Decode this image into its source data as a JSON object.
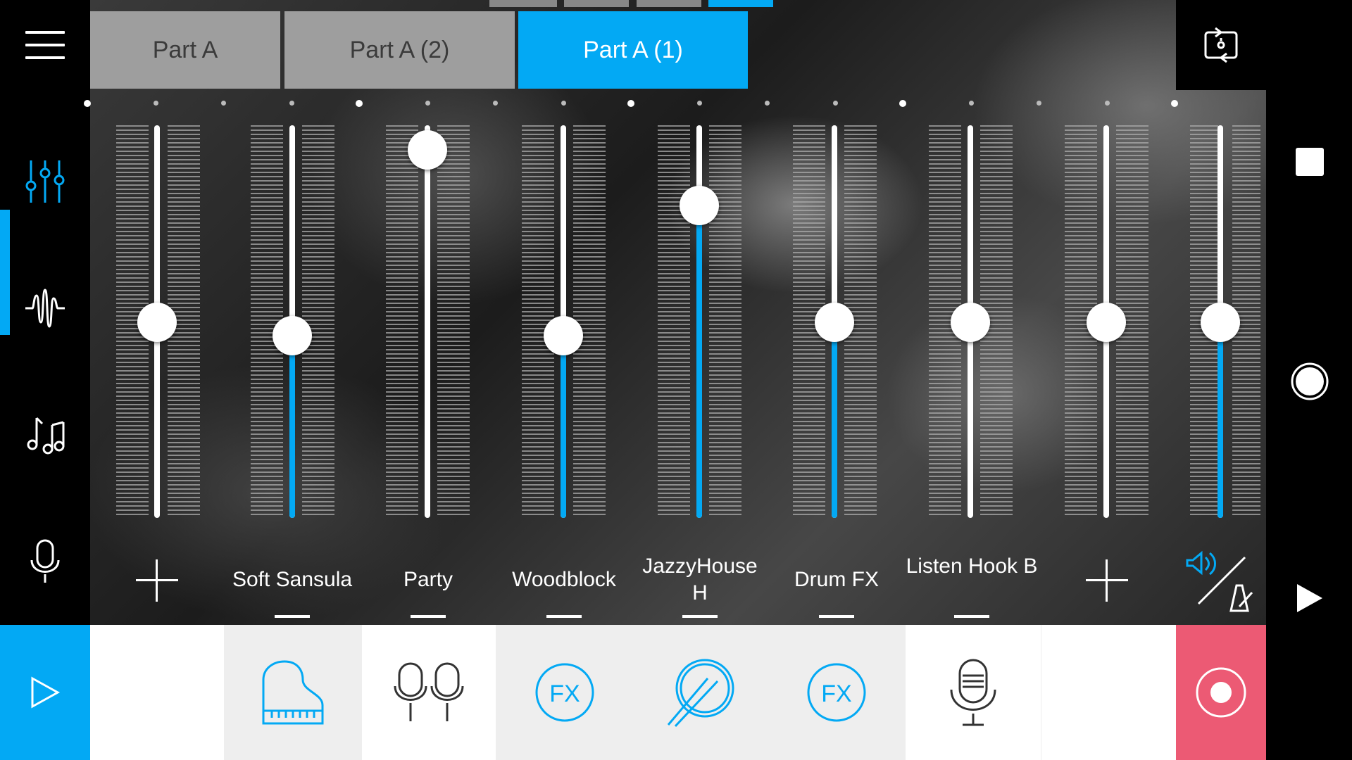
{
  "tabs": [
    {
      "label": "Part A"
    },
    {
      "label": "Part A (2)"
    },
    {
      "label": "Part A (1)"
    }
  ],
  "channels": [
    {
      "label": "",
      "level": 0.5
    },
    {
      "label": "Soft Sansula",
      "level": 0.47
    },
    {
      "label": "Party",
      "level": 0.95
    },
    {
      "label": "Woodblock",
      "level": 0.47
    },
    {
      "label": "JazzyHouse H",
      "level": 0.81
    },
    {
      "label": "Drum FX",
      "level": 0.5
    },
    {
      "label": "Listen Hook B",
      "level": 0.5
    },
    {
      "label": "",
      "level": 0.5
    },
    {
      "label": "",
      "level": 0.5
    }
  ],
  "colors": {
    "accent": "#03a9f4",
    "record": "#ec5a74"
  },
  "sidebar": {
    "items": [
      {
        "icon": "mixer-sliders-icon",
        "active": true
      },
      {
        "icon": "waveform-icon",
        "active": false
      },
      {
        "icon": "music-notes-icon",
        "active": false
      },
      {
        "icon": "microphone-icon",
        "active": false
      }
    ]
  },
  "instruments": [
    {
      "icon": "grand-piano-icon",
      "selected": true
    },
    {
      "icon": "double-microphone-icon",
      "selected": false
    },
    {
      "icon": "fx-icon",
      "selected": true
    },
    {
      "icon": "drum-sticks-icon",
      "selected": false
    },
    {
      "icon": "fx-icon",
      "selected": true
    },
    {
      "icon": "microphone-icon",
      "selected": false
    }
  ]
}
